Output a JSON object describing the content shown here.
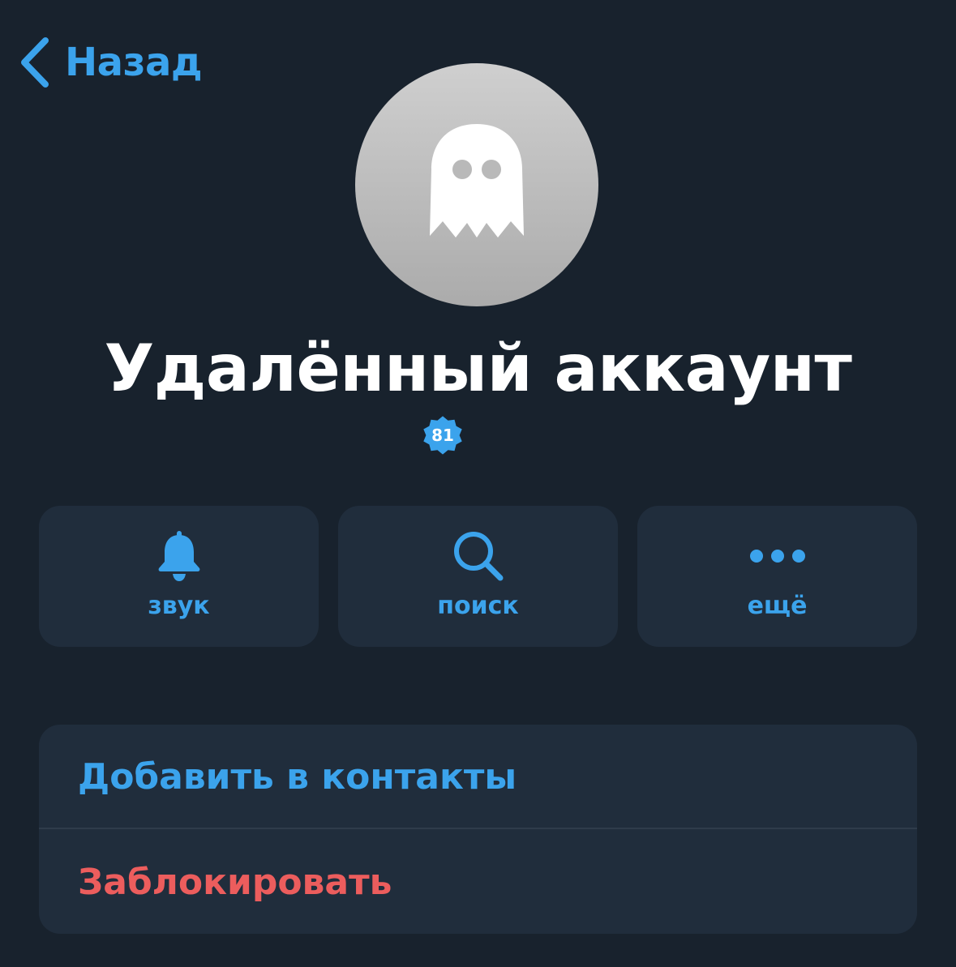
{
  "nav": {
    "back_label": "Назад",
    "back_icon": "chevron-left-icon"
  },
  "profile": {
    "avatar_icon": "ghost-icon",
    "name": "Удалённый аккаунт",
    "badge_value": "81",
    "badge_icon": "verified-badge-icon"
  },
  "actions": [
    {
      "label": "звук",
      "icon": "bell-icon"
    },
    {
      "label": "поиск",
      "icon": "search-icon"
    },
    {
      "label": "ещё",
      "icon": "more-dots-icon"
    }
  ],
  "list": {
    "add_contact_label": "Добавить в контакты",
    "block_label": "Заблокировать"
  },
  "colors": {
    "background": "#18222d",
    "card": "#202d3c",
    "accent": "#3ba3ec",
    "destructive": "#ec5d5d",
    "text": "#ffffff"
  }
}
